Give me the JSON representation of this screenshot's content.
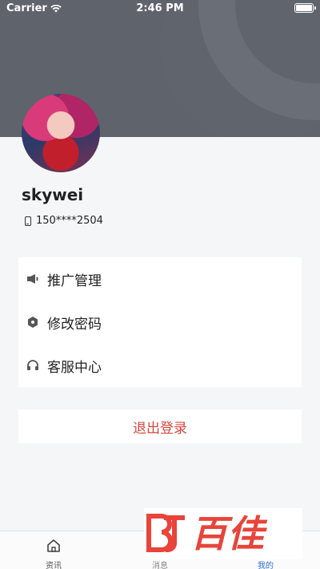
{
  "status_bar": {
    "carrier": "Carrier",
    "time": "2:46 PM"
  },
  "profile": {
    "username": "skywei",
    "phone": "150****2504"
  },
  "menu": {
    "items": [
      {
        "label": "推广管理",
        "icon": "megaphone-icon"
      },
      {
        "label": "修改密码",
        "icon": "hexagon-lock-icon"
      },
      {
        "label": "客服中心",
        "icon": "headset-icon"
      }
    ]
  },
  "logout_label": "退出登录",
  "tabbar": {
    "tabs": [
      {
        "label": "资讯",
        "icon": "home-icon",
        "active": false
      },
      {
        "label": "消息",
        "icon": "message-icon",
        "active": false
      },
      {
        "label": "我的",
        "icon": "user-icon",
        "active": true
      }
    ]
  },
  "watermark": {
    "text": "百佳"
  },
  "colors": {
    "header": "#5f636c",
    "accent": "#2f6fd8",
    "logout": "#d9463e",
    "watermark": "#e8443a"
  }
}
